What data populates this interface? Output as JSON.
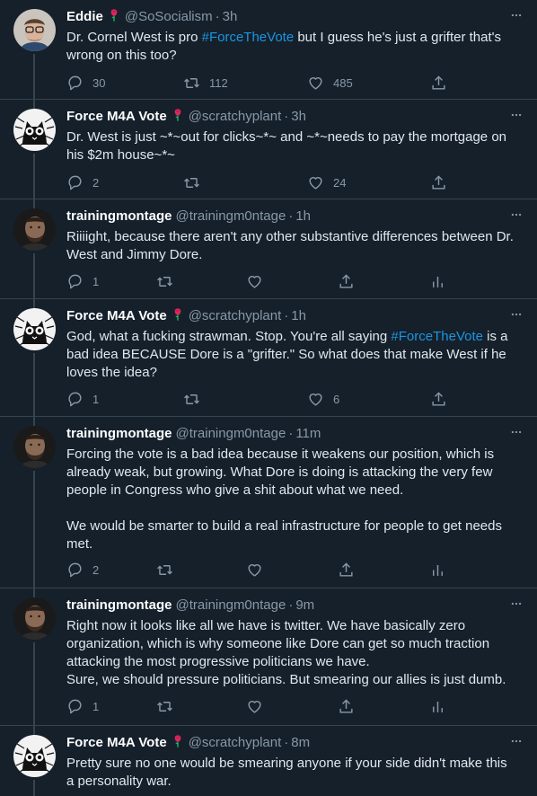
{
  "tweets": [
    {
      "name": "Eddie",
      "handle": "@SoSocialism",
      "time": "3h",
      "body": [
        {
          "t": "Dr. Cornel West is pro "
        },
        {
          "t": "#ForceTheVote",
          "tag": true
        },
        {
          "t": " but I guess he's just a grifter that's wrong on this too?"
        }
      ],
      "replies": "30",
      "retweets": "112",
      "likes": "485",
      "avatar_type": "person-glasses",
      "has_rose": true
    },
    {
      "name": "Force M4A Vote",
      "handle": "@scratchyplant",
      "time": "3h",
      "body": [
        {
          "t": "Dr. West is just ~*~out for clicks~*~ and ~*~needs to pay the mortgage on his $2m house~*~"
        }
      ],
      "replies": "2",
      "retweets": "",
      "likes": "24",
      "avatar_type": "cat",
      "has_rose": true
    },
    {
      "name": "trainingmontage",
      "handle": "@trainingm0ntage",
      "time": "1h",
      "body": [
        {
          "t": "Riiiight, because there aren't any other substantive differences between Dr. West and Jimmy Dore."
        }
      ],
      "replies": "1",
      "retweets": "",
      "likes": "",
      "avatar_type": "person-beard",
      "has_rose": false
    },
    {
      "name": "Force M4A Vote",
      "handle": "@scratchyplant",
      "time": "1h",
      "body": [
        {
          "t": "God, what a fucking strawman. Stop. You're all saying "
        },
        {
          "t": "#ForceTheVote",
          "tag": true
        },
        {
          "t": " is a bad idea BECAUSE Dore is a \"grifter.\" So what does  that make West if he loves the idea?"
        }
      ],
      "replies": "1",
      "retweets": "",
      "likes": "6",
      "avatar_type": "cat",
      "has_rose": true
    },
    {
      "name": "trainingmontage",
      "handle": "@trainingm0ntage",
      "time": "11m",
      "body": [
        {
          "t": "Forcing the vote is a bad idea because it weakens our position, which is already weak, but growing. What Dore is doing is attacking the very few people in Congress who give a shit about what we need."
        },
        {
          "br": true
        },
        {
          "br": true
        },
        {
          "t": "We would be smarter to build a real infrastructure for people to get needs met."
        }
      ],
      "replies": "2",
      "retweets": "",
      "likes": "",
      "avatar_type": "person-beard",
      "has_rose": false
    },
    {
      "name": "trainingmontage",
      "handle": "@trainingm0ntage",
      "time": "9m",
      "body": [
        {
          "t": "Right now it looks like all we have is twitter. We have basically zero organization, which is why someone like Dore can get so much traction attacking the most progressive politicians we have."
        },
        {
          "br": true
        },
        {
          "t": "Sure, we should pressure politicians. But smearing our allies is just dumb."
        }
      ],
      "replies": "1",
      "retweets": "",
      "likes": "",
      "avatar_type": "person-beard",
      "has_rose": false
    },
    {
      "name": "Force M4A Vote",
      "handle": "@scratchyplant",
      "time": "8m",
      "body": [
        {
          "t": "Pretty sure no one would be smearing anyone if your side didn't make this a personality war."
        }
      ],
      "replies": "",
      "retweets": "",
      "likes": "",
      "avatar_type": "cat",
      "has_rose": true
    }
  ],
  "colors": {
    "background": "#15202b",
    "text": "#e1e8ed",
    "muted": "#8899a6",
    "hashtag": "#1b95e0",
    "divider": "#38444d",
    "rose": "#e0245e"
  },
  "icons": {
    "reply": "reply-icon",
    "retweet": "retweet-icon",
    "like": "like-icon",
    "share": "share-icon",
    "analytics": "analytics-icon",
    "more": "more-icon",
    "rose": "rose-icon"
  }
}
